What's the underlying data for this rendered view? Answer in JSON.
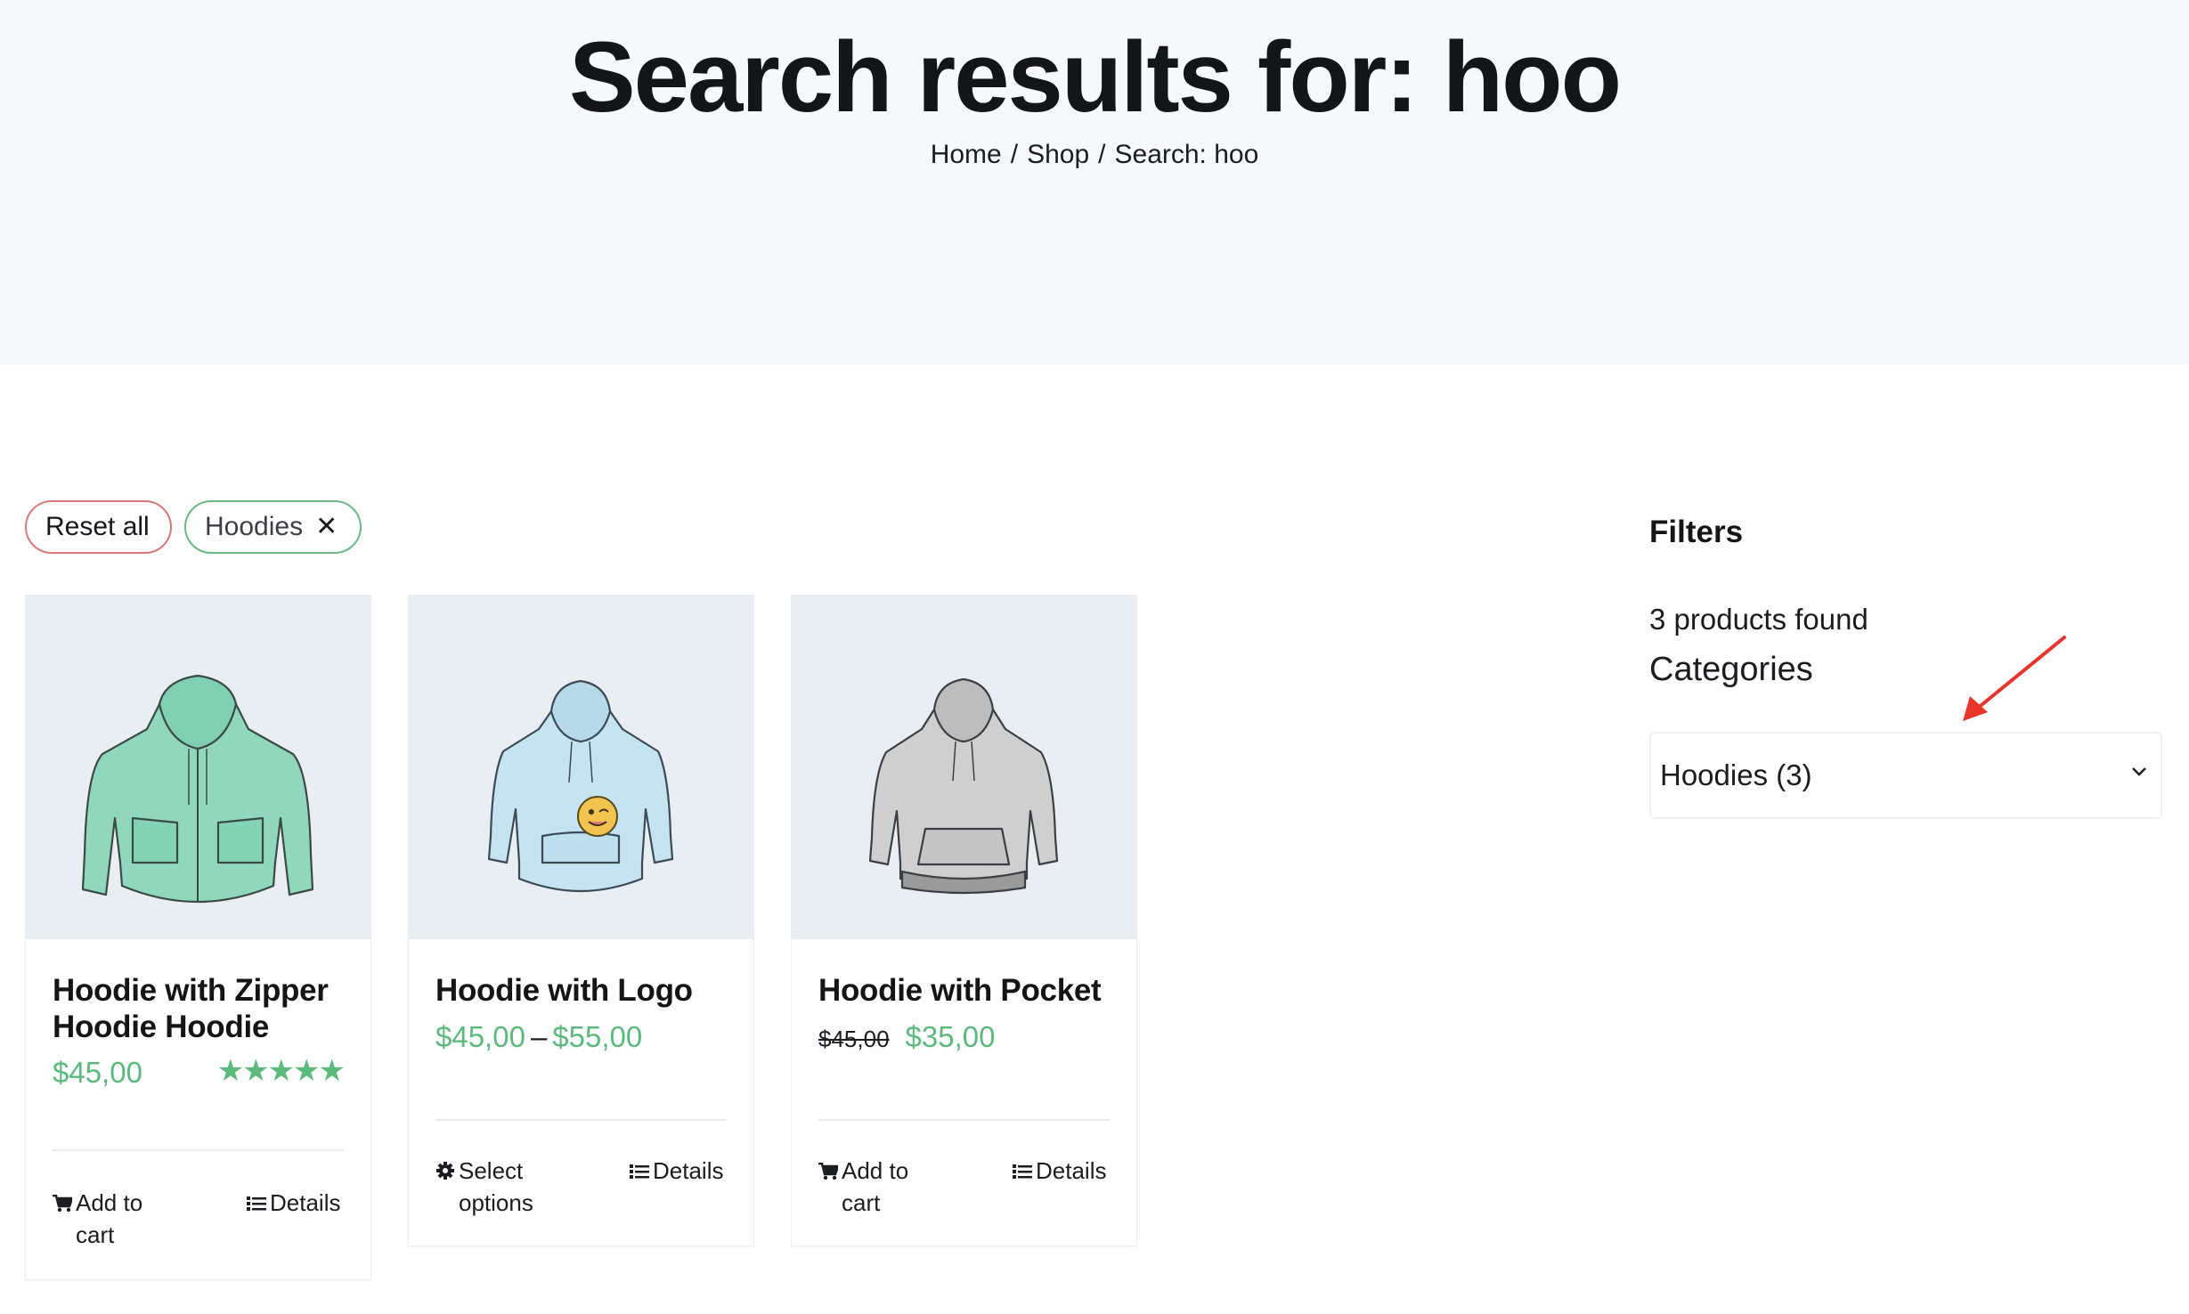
{
  "hero": {
    "title": "Search results for: hoo",
    "breadcrumb": [
      "Home",
      "Shop",
      "Search: hoo"
    ],
    "separator": "/"
  },
  "active_filters": {
    "reset_label": "Reset all",
    "chips": [
      {
        "label": "Hoodies",
        "remove_icon": "close-icon",
        "remove_glyph": "✕"
      }
    ]
  },
  "products": [
    {
      "title": "Hoodie with Zipper Hoodie Hoodie",
      "price": "$45,00",
      "rating": 5,
      "rating_stars": "★★★★★",
      "image_icon": "zip-hoodie-green",
      "action_primary": {
        "label": "Add to cart",
        "icon": "cart-icon"
      },
      "action_secondary": {
        "label": "Details",
        "icon": "list-icon"
      }
    },
    {
      "title": "Hoodie with Logo",
      "price_min": "$45,00",
      "price_dash": "–",
      "price_max": "$55,00",
      "image_icon": "hoodie-logo-blue",
      "action_primary": {
        "label": "Select options",
        "icon": "gear-icon"
      },
      "action_secondary": {
        "label": "Details",
        "icon": "list-icon"
      }
    },
    {
      "title": "Hoodie with Pocket",
      "price_old": "$45,00",
      "price": "$35,00",
      "image_icon": "hoodie-pocket-grey",
      "action_primary": {
        "label": "Add to cart",
        "icon": "cart-icon"
      },
      "action_secondary": {
        "label": "Details",
        "icon": "list-icon"
      }
    }
  ],
  "sidebar": {
    "title": "Filters",
    "found": "3 products found",
    "categories_title": "Categories",
    "category_select": {
      "value": "Hoodies (3)",
      "icon": "chevron-down-icon"
    },
    "annotation": "red-arrow"
  },
  "colors": {
    "accent_green": "#5dba7d",
    "reset_border": "#d97a7a",
    "chip_border": "#6ab987",
    "hero_bg": "#f7f8fa",
    "image_bg": "#e9eef3",
    "annotation_red": "#e8352a"
  }
}
